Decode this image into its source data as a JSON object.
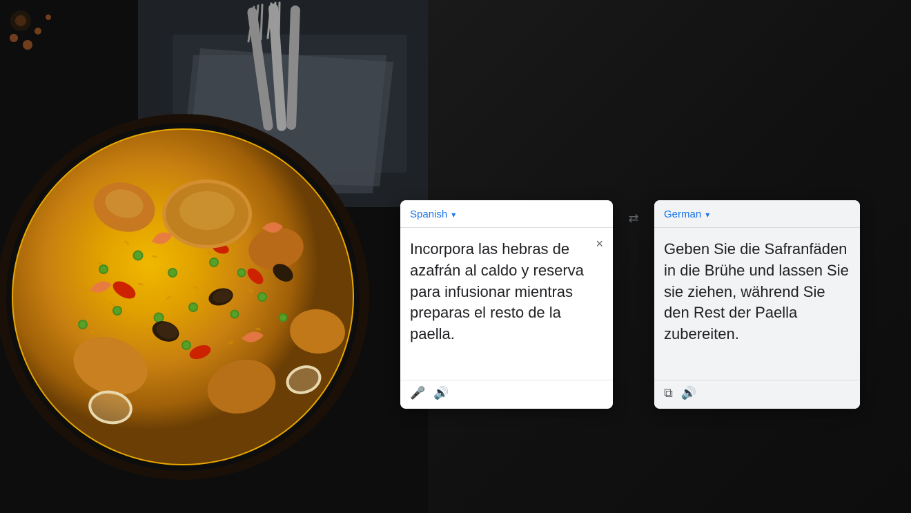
{
  "background": {
    "description": "Paella dish with yellow saffron rice, shrimp, chicken, mussels, green peas, and red peppers in dark cast iron pan on dark background"
  },
  "translator": {
    "source": {
      "language_label": "Spanish",
      "dropdown_arrow": "▾",
      "text": "Incorpora las hebras de azafrán al caldo y reserva para infusionar mientras preparas el resto de la paella.",
      "clear_button": "×",
      "mic_icon": "🎤",
      "speaker_icon": "🔊"
    },
    "swap_icon": "⇄",
    "target": {
      "language_label": "German",
      "dropdown_arrow": "▾",
      "text": "Geben Sie die Safranfäden in die Brühe und lassen Sie sie ziehen, während Sie den Rest der Paella zubereiten.",
      "copy_icon": "⧉",
      "speaker_icon": "🔊"
    }
  }
}
